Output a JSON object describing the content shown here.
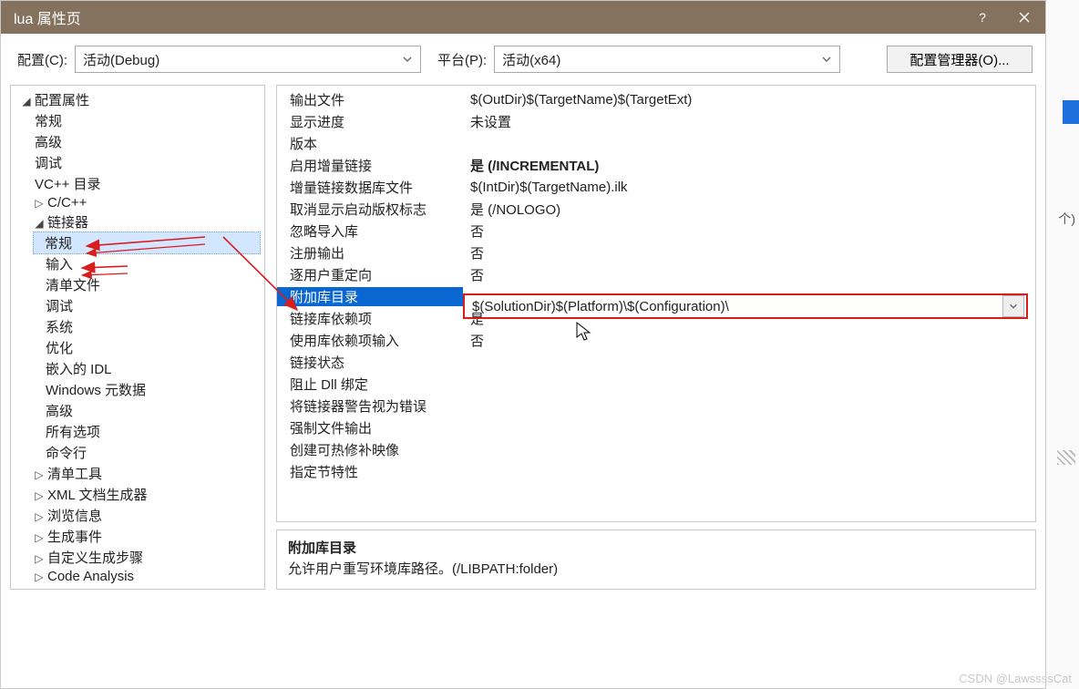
{
  "title": "lua 属性页",
  "toolbar": {
    "config_label": "配置(C):",
    "config_value": "活动(Debug)",
    "platform_label": "平台(P):",
    "platform_value": "活动(x64)",
    "config_manager": "配置管理器(O)..."
  },
  "tree": {
    "root": "配置属性",
    "n_general": "常规",
    "n_advanced": "高级",
    "n_debug": "调试",
    "n_vcpp": "VC++ 目录",
    "n_ccpp": "C/C++",
    "n_linker": "链接器",
    "linker": {
      "general": "常规",
      "input": "输入",
      "manifest": "清单文件",
      "debug": "调试",
      "system": "系统",
      "optim": "优化",
      "idl": "嵌入的 IDL",
      "winmd": "Windows 元数据",
      "adv": "高级",
      "all": "所有选项",
      "cmd": "命令行"
    },
    "n_manifest_tool": "清单工具",
    "n_xml": "XML 文档生成器",
    "n_browse": "浏览信息",
    "n_build": "生成事件",
    "n_custom": "自定义生成步骤",
    "n_code": "Code Analysis"
  },
  "grid": {
    "rows": [
      {
        "k": "输出文件",
        "v": "$(OutDir)$(TargetName)$(TargetExt)"
      },
      {
        "k": "显示进度",
        "v": "未设置"
      },
      {
        "k": "版本",
        "v": ""
      },
      {
        "k": "启用增量链接",
        "v": "是 (/INCREMENTAL)",
        "bold": true
      },
      {
        "k": "增量链接数据库文件",
        "v": "$(IntDir)$(TargetName).ilk"
      },
      {
        "k": "取消显示启动版权标志",
        "v": "是 (/NOLOGO)"
      },
      {
        "k": "忽略导入库",
        "v": "否"
      },
      {
        "k": "注册输出",
        "v": "否"
      },
      {
        "k": "逐用户重定向",
        "v": "否"
      },
      {
        "k": "附加库目录",
        "v": "$(SolutionDir)$(Platform)\\$(Configuration)\\",
        "hi": true
      },
      {
        "k": "链接库依赖项",
        "v": "是"
      },
      {
        "k": "使用库依赖项输入",
        "v": "否"
      },
      {
        "k": "链接状态",
        "v": ""
      },
      {
        "k": "阻止 Dll 绑定",
        "v": ""
      },
      {
        "k": "将链接器警告视为错误",
        "v": ""
      },
      {
        "k": "强制文件输出",
        "v": ""
      },
      {
        "k": "创建可热修补映像",
        "v": ""
      },
      {
        "k": "指定节特性",
        "v": ""
      }
    ]
  },
  "help": {
    "label": "附加库目录",
    "desc": "允许用户重写环境库路径。(/LIBPATH:folder)"
  },
  "rightedge_txt": "个)",
  "watermark": "CSDN @LawssssCat"
}
